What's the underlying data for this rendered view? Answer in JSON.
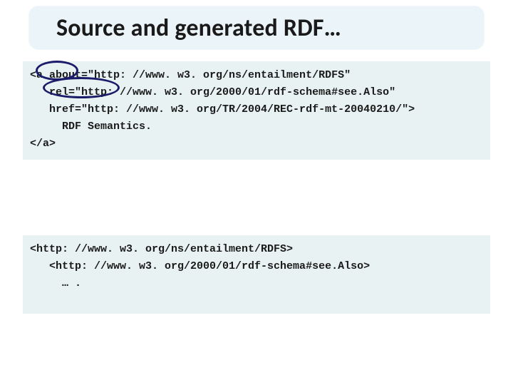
{
  "title": "Source and generated RDF…",
  "code_top": "<a about=\"http: //www. w3. org/ns/entailment/RDFS\"\n   rel=\"http: //www. w3. org/2000/01/rdf-schema#see.Also\"\n   href=\"http: //www. w3. org/TR/2004/REC-rdf-mt-20040210/\">\n     RDF Semantics.\n</a>",
  "code_bottom": "<http: //www. w3. org/ns/entailment/RDFS>\n   <http: //www. w3. org/2000/01/rdf-schema#see.Also>\n     … .",
  "annotations": {
    "about_label": "about-attr-circle",
    "rel_label": "rel-attr-circle"
  }
}
